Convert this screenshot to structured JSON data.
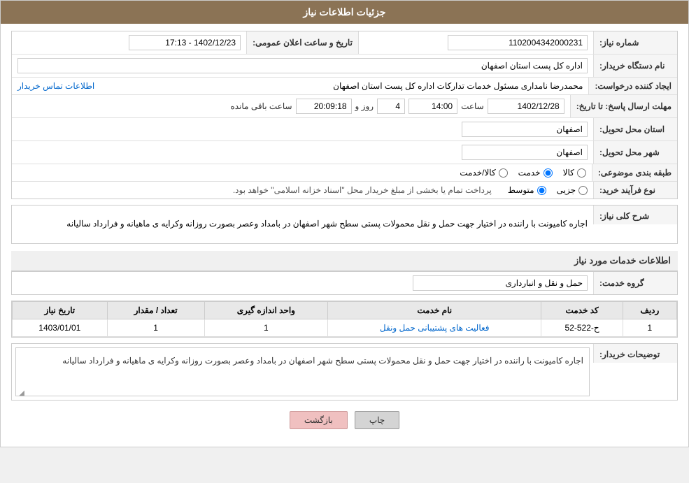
{
  "header": {
    "title": "جزئیات اطلاعات نیاز"
  },
  "fields": {
    "shomara_niaz_label": "شماره نیاز:",
    "shomara_niaz_value": "1102004342000231",
    "nam_dastgah_label": "نام دستگاه خریدار:",
    "nam_dastgah_value": "اداره کل پست استان اصفهان",
    "ijad_konande_label": "ایجاد کننده درخواست:",
    "ijad_konande_value": "محمدرضا نامداری مسئول خدمات تدارکات اداره کل پست استان اصفهان",
    "ijad_konande_link": "اطلاعات تماس خریدار",
    "mohlet_ersal_label": "مهلت ارسال پاسخ: تا تاریخ:",
    "mohlet_date": "1402/12/28",
    "mohlet_saat_label": "ساعت",
    "mohlet_saat_value": "14:00",
    "mohlet_roz_label": "روز و",
    "mohlet_roz_value": "4",
    "baqi_saat_label": "ساعت باقی مانده",
    "baqi_saat_value": "20:09:18",
    "ostan_tahvil_label": "استان محل تحویل:",
    "ostan_tahvil_value": "اصفهان",
    "shahr_tahvil_label": "شهر محل تحویل:",
    "shahr_tahvil_value": "اصفهان",
    "tasnif_label": "طبقه بندی موضوعی:",
    "tasnif_kala": "کالا",
    "tasnif_khedmat": "خدمت",
    "tasnif_kala_khedmat": "کالا/خدمت",
    "tarikh_elan_label": "تاریخ و ساعت اعلان عمومی:",
    "tarikh_elan_value": "1402/12/23 - 17:13",
    "noع_farayand_label": "نوع فرآیند خرید:",
    "noع_farayand_jozvi": "جزیی",
    "noع_farayand_motovaset": "متوسط",
    "noع_farayand_description": "پرداخت تمام یا بخشی از مبلغ خریدار محل \"اسناد خزانه اسلامی\" خواهد بود.",
    "sharh_label": "شرح کلی نیاز:",
    "sharh_value": "اجاره کامیونت با راننده در اختیار جهت حمل و نقل محمولات پستی سطح شهر اصفهان در بامداد وعصر  بصورت روزانه وکرایه ی ماهیانه و فرارداد سالیانه",
    "khedmat_section_title": "اطلاعات خدمات مورد نیاز",
    "goroh_khedmat_label": "گروه خدمت:",
    "goroh_khedmat_value": "حمل و نقل و انبارداری",
    "table": {
      "headers": [
        "ردیف",
        "کد خدمت",
        "نام خدمت",
        "واحد اندازه گیری",
        "تعداد / مقدار",
        "تاریخ نیاز"
      ],
      "rows": [
        {
          "radif": "1",
          "kod": "ح-522-52",
          "name": "فعالیت های پشتیبانی حمل ونقل",
          "vahid": "1",
          "tedad": "1",
          "tarikh": "1403/01/01"
        }
      ]
    },
    "tosif_label": "توضیحات خریدار:",
    "tosif_value": "اجاره کامیونت با راننده در اختیار جهت حمل و نقل محمولات پستی سطح شهر اصفهان در بامداد وعصر  بصورت روزانه وکرایه ی ماهیانه و فرارداد سالیانه"
  },
  "buttons": {
    "print_label": "چاپ",
    "back_label": "بازگشت"
  }
}
